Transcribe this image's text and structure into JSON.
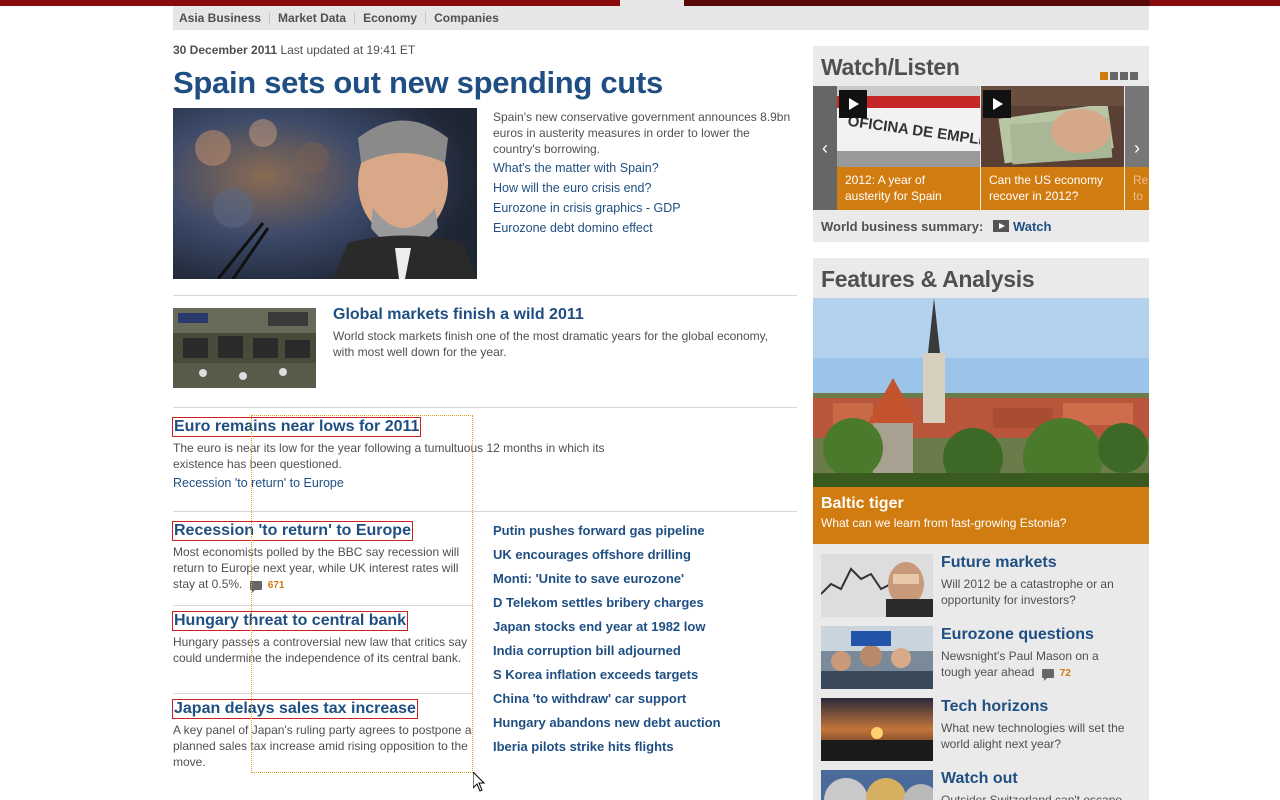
{
  "subnav": [
    "Asia Business",
    "Market Data",
    "Economy",
    "Companies"
  ],
  "date": {
    "bold": "30 December 2011",
    "rest": "Last updated at 19:41 ET"
  },
  "lead": {
    "title": "Spain sets out new spending cuts",
    "summary": "Spain's new conservative government announces 8.9bn euros in austerity measures in order to lower the country's borrowing.",
    "links": [
      "What's the matter with Spain?",
      "How will the euro crisis end?",
      "Eurozone in crisis graphics - GDP",
      "Eurozone debt domino effect"
    ]
  },
  "story2": {
    "title": "Global markets finish a wild 2011",
    "summary": "World stock markets finish one of the most dramatic years for the global economy, with most well down for the year."
  },
  "story3": {
    "title": "Euro remains near lows for 2011",
    "summary": "The euro is near its low for the year following a tumultuous 12 months in which its existence has been questioned.",
    "link": "Recession 'to return' to Europe"
  },
  "story4": {
    "title": "Recession 'to return' to Europe",
    "summary": "Most economists polled by the BBC say recession will return to Europe next year, while UK interest rates will stay at 0.5%.",
    "comments": "671"
  },
  "story5": {
    "title": "Hungary threat to central bank",
    "summary": "Hungary passes a controversial new law that critics say could undermine the independence of its central bank."
  },
  "story6": {
    "title": "Japan delays sales tax increase",
    "summary": "A key panel of Japan's ruling party agrees to postpone a planned sales tax increase amid rising opposition to the move."
  },
  "headlines": [
    "Putin pushes forward gas pipeline",
    "UK encourages offshore drilling",
    "Monti: 'Unite to save eurozone'",
    "D Telekom settles bribery charges",
    "Japan stocks end year at 1982 low",
    "India corruption bill adjourned",
    "S Korea inflation exceeds targets",
    "China 'to withdraw' car support",
    "Hungary abandons new debt auction",
    "Iberia pilots strike hits flights"
  ],
  "watch": {
    "title": "Watch/Listen",
    "videos": [
      "2012: A year of austerity for Spain",
      "Can the US economy recover in 2012?"
    ],
    "partial_caption": "Re to",
    "summary_label": "World business summary:",
    "summary_link": "Watch"
  },
  "features": {
    "title": "Features & Analysis",
    "hero_title": "Baltic tiger",
    "hero_desc": "What can we learn from fast-growing Estonia?",
    "items": [
      {
        "title": "Future markets",
        "desc": "Will 2012 be a catastrophe or an opportunity for investors?"
      },
      {
        "title": "Eurozone questions",
        "desc": "Newsnight's Paul Mason on a tough year ahead",
        "comments": "72"
      },
      {
        "title": "Tech horizons",
        "desc": "What new technologies will set the world alight next year?"
      },
      {
        "title": "Watch out",
        "desc": "Outsider Switzerland can't escape"
      }
    ]
  },
  "colors": {
    "link_blue": "#1f4f82",
    "accent_orange": "#d17c10",
    "panel_grey": "#eaeaea"
  }
}
